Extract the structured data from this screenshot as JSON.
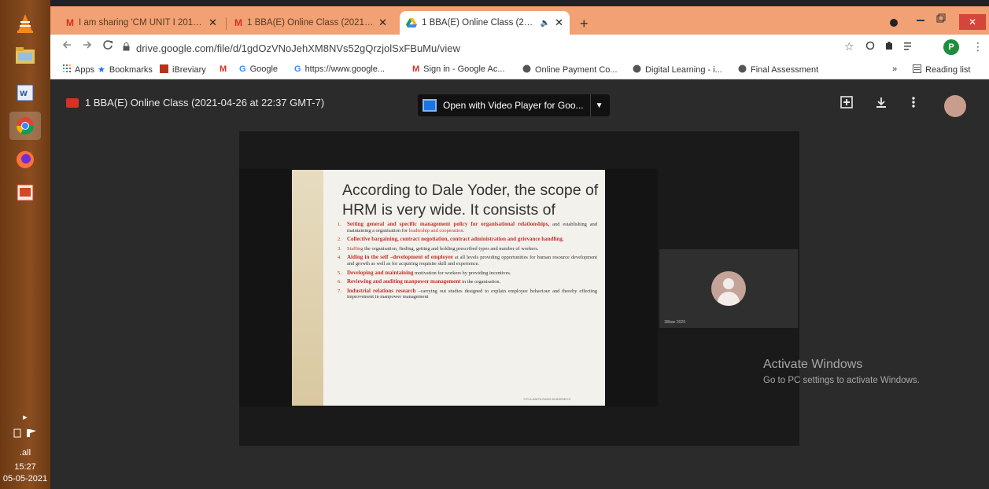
{
  "taskbar": {
    "icons": [
      "vlc-icon",
      "file-explorer-icon",
      "word-icon",
      "chrome-icon",
      "firefox-icon",
      "powerpoint-icon"
    ],
    "time": "15:27",
    "date": "05-05-2021",
    "expand_glyph": "▸",
    "signal_label": ".all"
  },
  "browser": {
    "tabs": [
      {
        "title": "I am sharing 'CM UNIT I 2014' w...",
        "favicon": "gmail-icon"
      },
      {
        "title": "1 BBA(E) Online Class (2021-04-2...",
        "favicon": "gmail-icon"
      },
      {
        "title": "1 BBA(E) Online Class (2021-...",
        "favicon": "drive-icon",
        "active": true
      }
    ],
    "close_glyph": "✕",
    "newtab_glyph": "+",
    "url": "drive.google.com/file/d/1gdOzVNoJehXM8NVs52gQrzjolSxFBuMu/view",
    "profile_letter": "P",
    "bookmarks": [
      {
        "label": "Apps",
        "icon": "apps-grid-icon"
      },
      {
        "label": "Bookmarks",
        "icon": "star-icon"
      },
      {
        "label": "iBreviary",
        "icon": "ibreviary-icon"
      },
      {
        "label": "",
        "icon": "gmail-icon"
      },
      {
        "label": "Google",
        "icon": "google-icon"
      },
      {
        "label": "https://www.google...",
        "icon": "google-icon"
      },
      {
        "label": "Sign in - Google Ac...",
        "icon": "gmail-icon"
      },
      {
        "label": "Online Payment Co...",
        "icon": "globe-icon"
      },
      {
        "label": "Digital Learning - i...",
        "icon": "globe-icon"
      },
      {
        "label": "Final Assessment",
        "icon": "globe-icon"
      }
    ],
    "more_bookmarks": "»",
    "reading_list": "Reading list"
  },
  "viewer": {
    "title": "1 BBA(E) Online Class (2021-04-26 at 22:37 GMT-7)",
    "open_with": "Open with Video Player for Goo...",
    "slide": {
      "title": "According to Dale Yoder, the scope of HRM is very wide. It consists of",
      "items": [
        {
          "num": "1.",
          "bold": "Setting general and specific management policy for organisational relationships,",
          "text": " and establishing and maintaining a organisation for ",
          "tail": "leadership and cooperation."
        },
        {
          "num": "2.",
          "bold": "Collective bargaining, contract negotiation, contract administration and grievance handling.",
          "text": "",
          "tail": ""
        },
        {
          "num": "3.",
          "bold": "Staffing",
          "text": " the organisation, finding, getting and holding prescribed types and number of workers.",
          "tail": ""
        },
        {
          "num": "4.",
          "bold": "Aiding in the self –development of employee",
          "text": " at all levels providing opportunities for human resource development and growth as well as for acquiring requisite skill and experience.",
          "tail": ""
        },
        {
          "num": "5.",
          "bold": "Developing and maintaining",
          "text": " motivation for workers by providing incentives.",
          "tail": ""
        },
        {
          "num": "6.",
          "bold": "Reviewing and auditing manpower management",
          "text": " in the organisation.",
          "tail": ""
        },
        {
          "num": "7.",
          "bold": "Industrial relations research",
          "text": " –carrying out studies designed to explain employee behaviour and thereby effecting improvement in manpower management",
          "tail": ""
        }
      ],
      "footer": "S.R.A.ANITA  DASH ACADEMICS"
    },
    "participant_name": "1Bbae 2020"
  },
  "watermark": {
    "line1": "Activate Windows",
    "line2": "Go to PC settings to activate Windows."
  }
}
